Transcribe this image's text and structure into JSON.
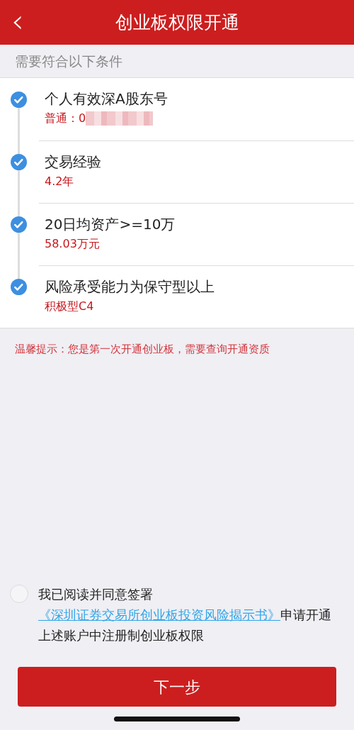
{
  "header": {
    "back": "‹",
    "title": "创业板权限开通"
  },
  "section_title": "需要符合以下条件",
  "conditions": [
    {
      "title": "个人有效深A股东号",
      "value": "普通：0",
      "met": true,
      "redacted": true
    },
    {
      "title": "交易经验",
      "value": "4.2年",
      "met": true
    },
    {
      "title": "20日均资产>=10万",
      "value": "58.03万元",
      "met": true
    },
    {
      "title": "风险承受能力为保守型以上",
      "value": "积极型C4",
      "met": true
    }
  ],
  "tip": "温馨提示：您是第一次开通创业板，需要查询开通资质",
  "agreement": {
    "checked": false,
    "before": "我已阅读并同意签署",
    "link": "《深圳证券交易所创业板投资风险揭示书》",
    "after": "申请开通上述账户中注册制创业板权限"
  },
  "next_button": "下一步"
}
